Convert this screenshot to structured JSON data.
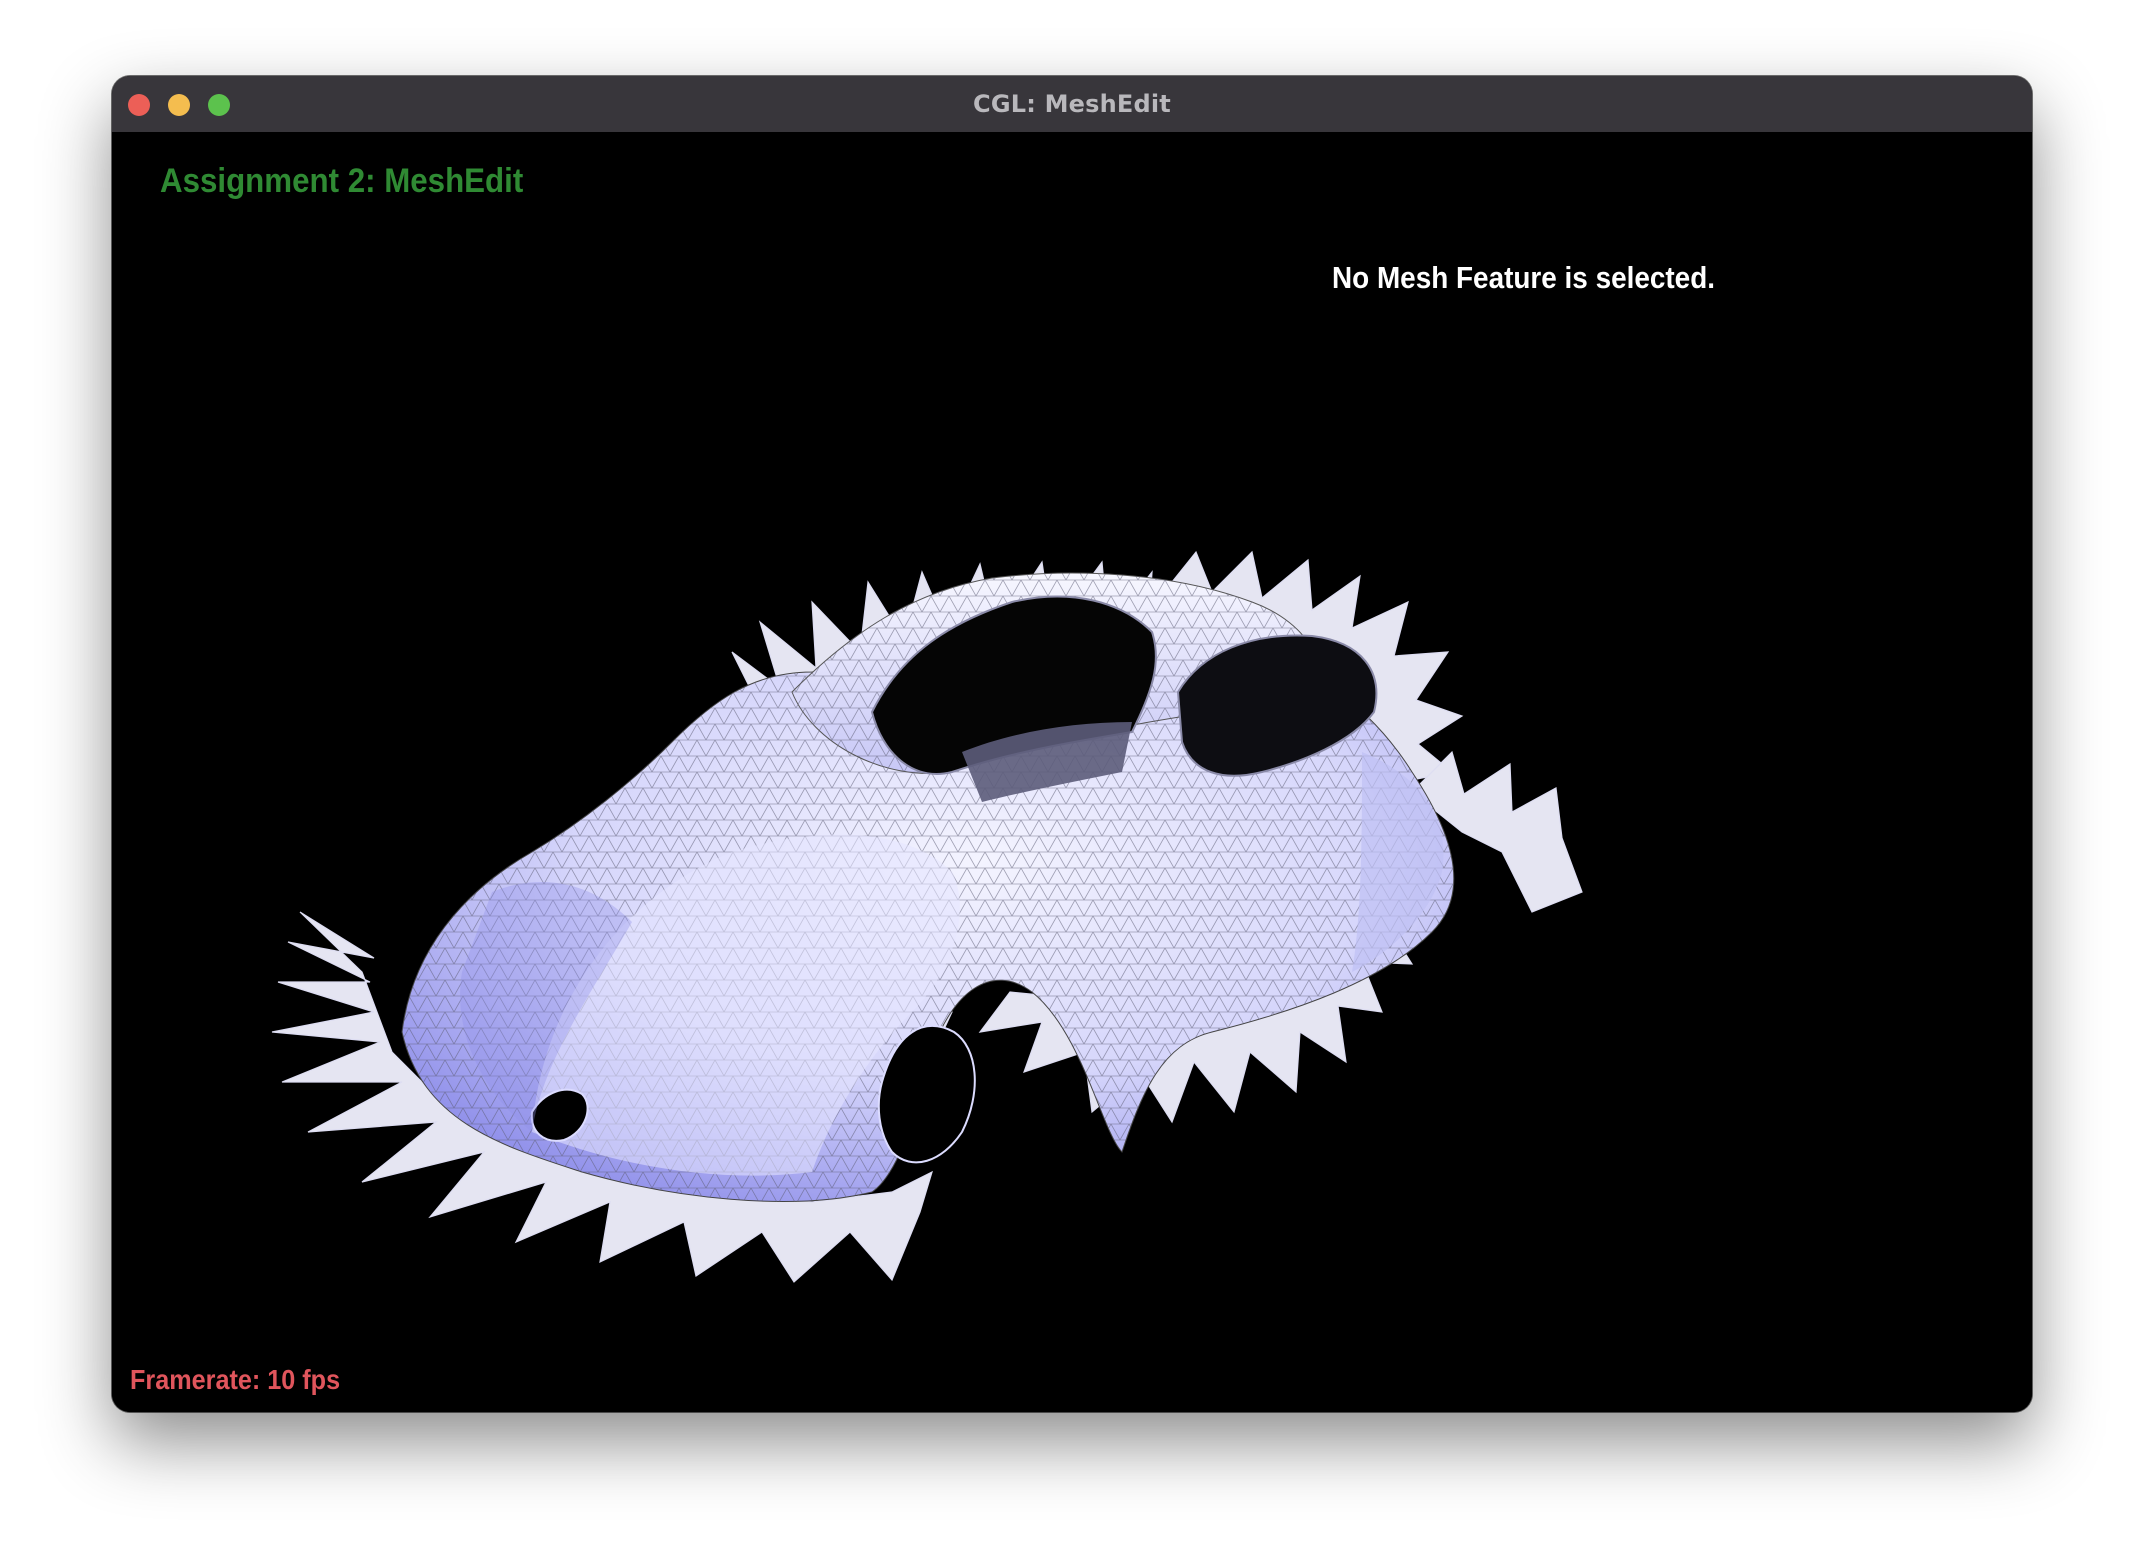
{
  "window": {
    "title": "CGL: MeshEdit"
  },
  "viewport": {
    "assignment_label": "Assignment 2: MeshEdit",
    "selection_status": "No Mesh Feature is selected.",
    "framerate_label": "Framerate: 10 fps"
  },
  "colors": {
    "titlebar": "#38363b",
    "assignment_label": "#2f8a33",
    "framerate_label": "#e0555c",
    "mesh_fill": "#c9c9f4",
    "mesh_shadow": "#7b7be6",
    "background": "#000000"
  }
}
